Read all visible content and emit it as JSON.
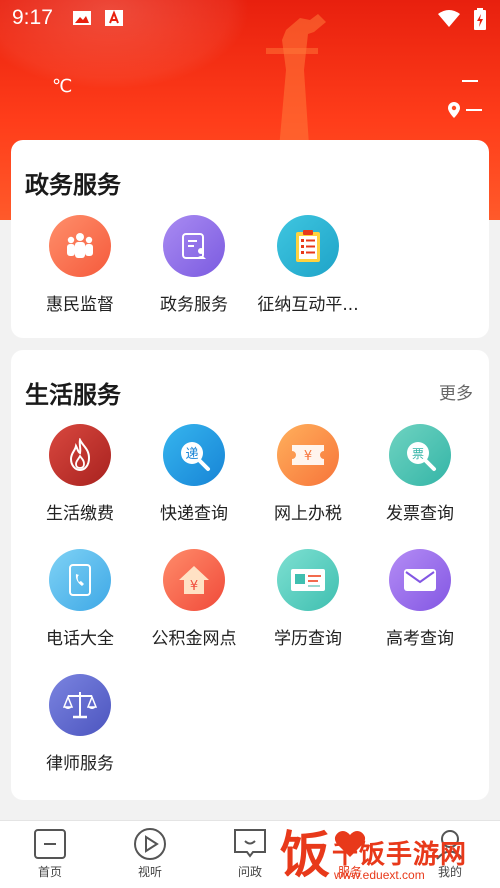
{
  "status": {
    "time": "9:17"
  },
  "weather": {
    "temperature_unit": "℃"
  },
  "gov_services": {
    "title": "政务服务",
    "items": [
      {
        "label": "惠民监督",
        "icon": "people-group-icon"
      },
      {
        "label": "政务服务",
        "icon": "document-user-icon"
      },
      {
        "label": "征纳互动平...",
        "icon": "clipboard-list-icon"
      }
    ]
  },
  "life_services": {
    "title": "生活服务",
    "more": "更多",
    "items": [
      {
        "label": "生活缴费",
        "icon": "fire-icon"
      },
      {
        "label": "快递查询",
        "icon": "express-search-icon",
        "glyph": "递"
      },
      {
        "label": "网上办税",
        "icon": "tax-ticket-icon",
        "glyph": "¥"
      },
      {
        "label": "发票查询",
        "icon": "invoice-search-icon",
        "glyph": "票"
      },
      {
        "label": "电话大全",
        "icon": "phone-book-icon"
      },
      {
        "label": "公积金网点",
        "icon": "housing-fund-icon",
        "glyph": "¥"
      },
      {
        "label": "学历查询",
        "icon": "id-card-icon"
      },
      {
        "label": "高考查询",
        "icon": "mail-icon"
      },
      {
        "label": "律师服务",
        "icon": "scales-icon"
      }
    ]
  },
  "tabbar": {
    "tabs": [
      {
        "label": "首页",
        "icon": "home-icon"
      },
      {
        "label": "视听",
        "icon": "play-icon"
      },
      {
        "label": "问政",
        "icon": "message-icon"
      },
      {
        "label": "服务",
        "icon": "heart-icon"
      },
      {
        "label": "我的",
        "icon": "user-icon"
      }
    ]
  },
  "watermark": {
    "logo": "饭",
    "text": "千饭手游网",
    "url": "www.eduext.com"
  },
  "colors": {
    "header_red": "#e8200e",
    "accent": "#e8391a"
  }
}
